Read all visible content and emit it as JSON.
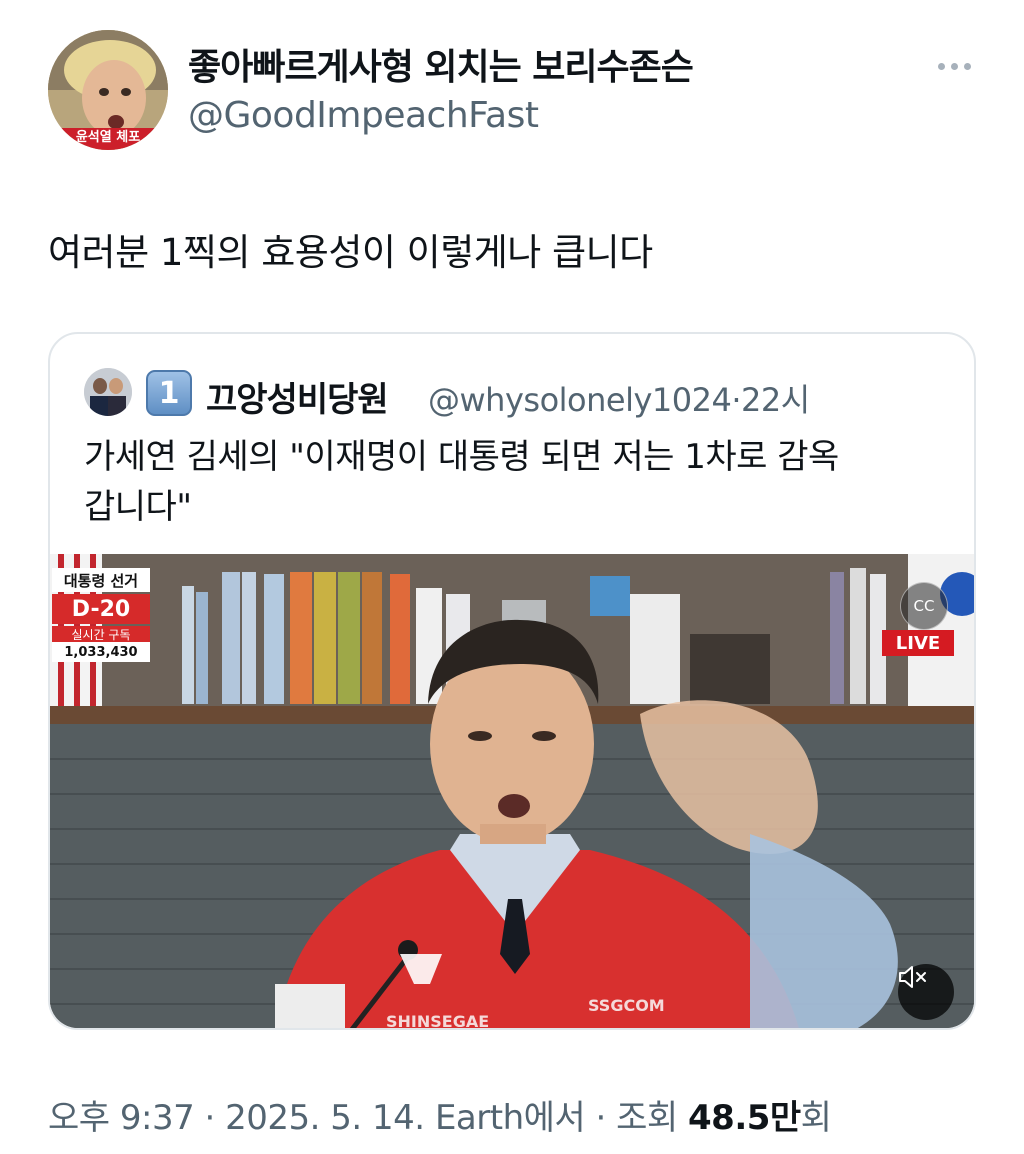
{
  "tweet": {
    "author": {
      "display_name": "좋아빠르게사형 외치는 보리수존슨",
      "handle": "@GoodImpeachFast",
      "avatar_caption": "윤석열 체포"
    },
    "text": "여러분 1찍의 효용성이 이렇게나 큽니다",
    "footer": {
      "time": "오후 9:37",
      "date": "2025. 5. 14.",
      "source": "Earth에서",
      "views_label": "조회",
      "views_value": "48.5만",
      "views_unit": "회"
    }
  },
  "quote": {
    "badge": "1",
    "display_name": "끄앙성비당원",
    "handle": "@whysolonely1024",
    "age": "22시",
    "text_line1": "가세연 김세의 \"이재명이 대통령 되면 저는 1차로 감옥",
    "text_line2": "갑니다\"",
    "video": {
      "overlay_title": "대통령 선거",
      "overlay_dday": "D-20",
      "overlay_sub": "실시간 구독",
      "overlay_count": "1,033,430",
      "live_label": "LIVE",
      "cc_label": "CC",
      "jersey_left": "SHINSEGAE",
      "jersey_right": "SSGCOM"
    }
  }
}
